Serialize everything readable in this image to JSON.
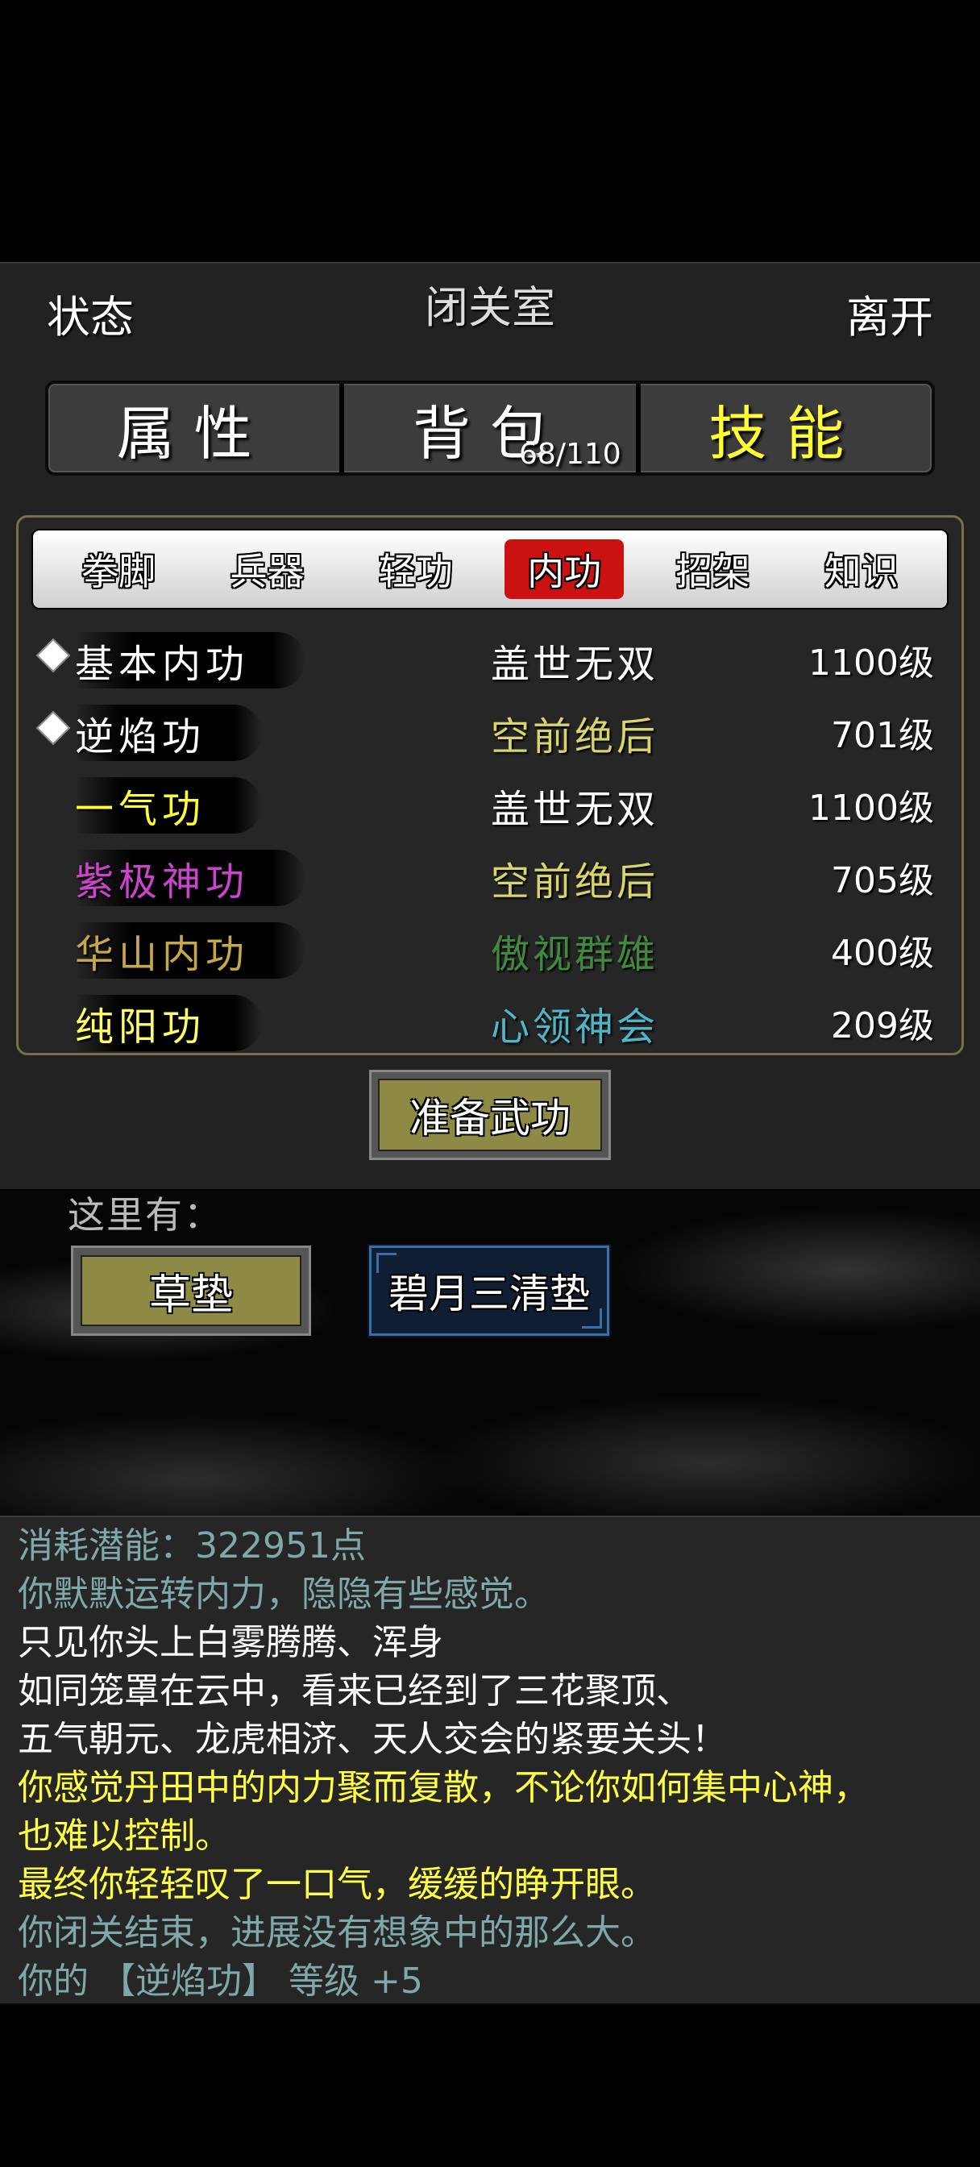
{
  "header": {
    "status_label": "状态",
    "title": "闭关室",
    "leave_label": "离开"
  },
  "main_tabs": [
    {
      "label": "属性",
      "active": false
    },
    {
      "label": "背包",
      "count": "68/110",
      "active": false
    },
    {
      "label": "技能",
      "active": true
    }
  ],
  "skill_tabs": [
    {
      "label": "拳脚",
      "active": false
    },
    {
      "label": "兵器",
      "active": false
    },
    {
      "label": "轻功",
      "active": false
    },
    {
      "label": "内功",
      "active": true
    },
    {
      "label": "招架",
      "active": false
    },
    {
      "label": "知识",
      "active": false
    }
  ],
  "skills": [
    {
      "name": "基本内功",
      "grade": "盖世无双",
      "level": "1100级",
      "marked": true,
      "name_color": "#ffffff",
      "grade_color": "#ffffff"
    },
    {
      "name": "逆焰功",
      "grade": "空前绝后",
      "level": "701级",
      "marked": true,
      "name_color": "#ffffff",
      "grade_color": "#d6d66a"
    },
    {
      "name": "一气功",
      "grade": "盖世无双",
      "level": "1100级",
      "marked": false,
      "name_color": "#ffff33",
      "grade_color": "#ffffff"
    },
    {
      "name": "紫极神功",
      "grade": "空前绝后",
      "level": "705级",
      "marked": false,
      "name_color": "#cc44cc",
      "grade_color": "#d6d66a"
    },
    {
      "name": "华山内功",
      "grade": "傲视群雄",
      "level": "400级",
      "marked": false,
      "name_color": "#c8a64a",
      "grade_color": "#3f8a3f"
    },
    {
      "name": "纯阳功",
      "grade": "心领神会",
      "level": "209级",
      "marked": false,
      "name_color": "#ffff66",
      "grade_color": "#4fb6c8"
    }
  ],
  "prepare_button": "准备武功",
  "scene": {
    "here_label": "这里有：",
    "objects": [
      "草垫",
      "碧月三清垫"
    ]
  },
  "log": [
    {
      "text": "消耗潜能：322951点",
      "color": "#7fa8a8"
    },
    {
      "text": "你默默运转内力，隐隐有些感觉。",
      "color": "#7fa8a8"
    },
    {
      "text": "只见你头上白雾腾腾、浑身",
      "color": "#ffffff"
    },
    {
      "text": "如同笼罩在云中，看来已经到了三花聚顶、",
      "color": "#ffffff"
    },
    {
      "text": "五气朝元、龙虎相济、天人交会的紧要关头！",
      "color": "#ffffff"
    },
    {
      "text": "你感觉丹田中的内力聚而复散，不论你如何集中心神，",
      "color": "#ffff44"
    },
    {
      "text": "也难以控制。",
      "color": "#ffff44"
    },
    {
      "text": "最终你轻轻叹了一口气，缓缓的睁开眼。",
      "color": "#ffff44"
    },
    {
      "text": "你闭关结束，进展没有想象中的那么大。",
      "color": "#7fa8a8"
    },
    {
      "text": "你的 【逆焰功】 等级 +5",
      "color": "#7fa8a8"
    }
  ]
}
